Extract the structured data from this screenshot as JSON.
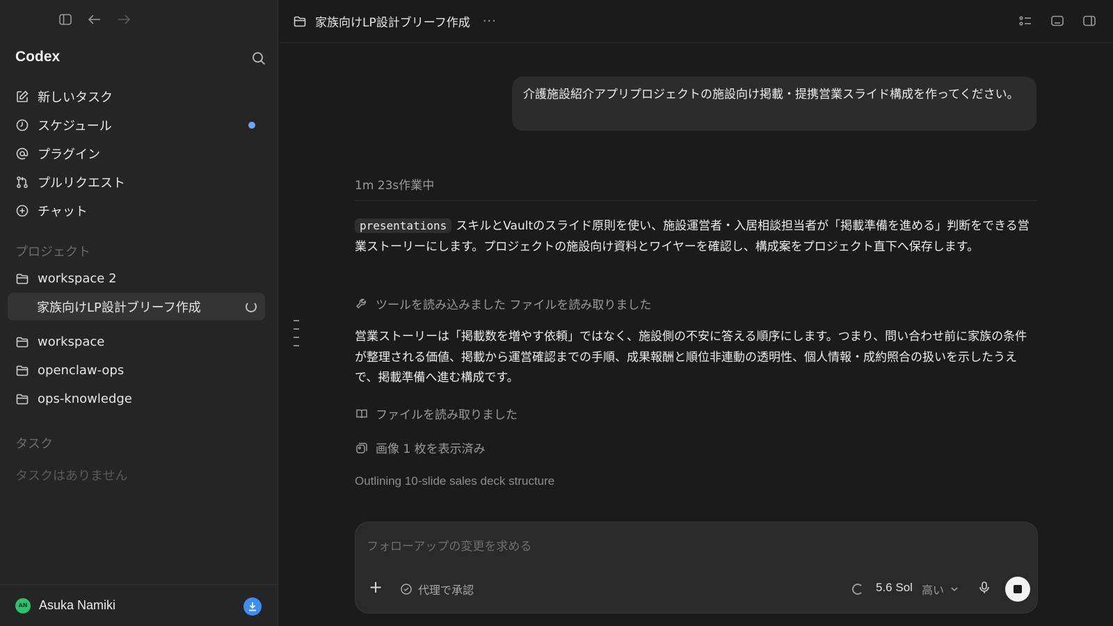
{
  "sidebar": {
    "app_name": "Codex",
    "nav": [
      {
        "label": "新しいタスク",
        "icon": "edit-icon"
      },
      {
        "label": "スケジュール",
        "icon": "clock-icon",
        "badge_dot": true
      },
      {
        "label": "プラグイン",
        "icon": "at-icon"
      },
      {
        "label": "プルリクエスト",
        "icon": "pull-request-icon"
      },
      {
        "label": "チャット",
        "icon": "chat-plus-icon"
      }
    ],
    "projects_label": "プロジェクト",
    "projects": [
      {
        "label": "workspace 2",
        "icon": "folder-icon"
      },
      {
        "label": "家族向けLP設計ブリーフ作成",
        "active": true,
        "icon": "spinner-icon"
      },
      {
        "label": "workspace",
        "icon": "folder-icon"
      },
      {
        "label": "openclaw-ops",
        "icon": "folder-icon"
      },
      {
        "label": "ops-knowledge",
        "icon": "folder-icon"
      }
    ],
    "tasks_label": "タスク",
    "no_tasks": "タスクはありません",
    "user": {
      "initials": "AN",
      "name": "Asuka Namiki",
      "avatar_color": "#2fbf71"
    },
    "download_color": "#3d8ef0"
  },
  "topbar": {
    "title": "家族向けLP設計ブリーフ作成",
    "more": "···"
  },
  "conversation": {
    "user_message": "介護施設紹介アプリプロジェクトの施設向け掲載・提携営業スライド構成を作ってください。",
    "work_time": "1m 23s作業中",
    "para1_code": "presentations",
    "para1_text": "スキルとVaultのスライド原則を使い、施設運営者・入居相談担当者が「掲載準備を進める」判断をできる営業ストーリーにします。プロジェクトの施設向け資料とワイヤーを確認し、構成案をプロジェクト直下へ保存します。",
    "tool1": "ツールを読み込みました ファイルを読み取りました",
    "para2": "営業ストーリーは「掲載数を増やす依頼」ではなく、施設側の不安に答える順序にします。つまり、問い合わせ前に家族の条件が整理される価値、掲載から運営確認までの手順、成果報酬と順位非連動の透明性、個人情報・成約照合の扱いを示したうえで、掲載準備へ進む構成です。",
    "tool2": "ファイルを読み取りました",
    "tool3": "画像 1 枚を表示済み",
    "status": "Outlining 10-slide sales deck structure"
  },
  "composer": {
    "placeholder": "フォローアップの変更を求める",
    "approve_label": "代理で承認",
    "model": "5.6 Sol",
    "effort": "高い"
  }
}
